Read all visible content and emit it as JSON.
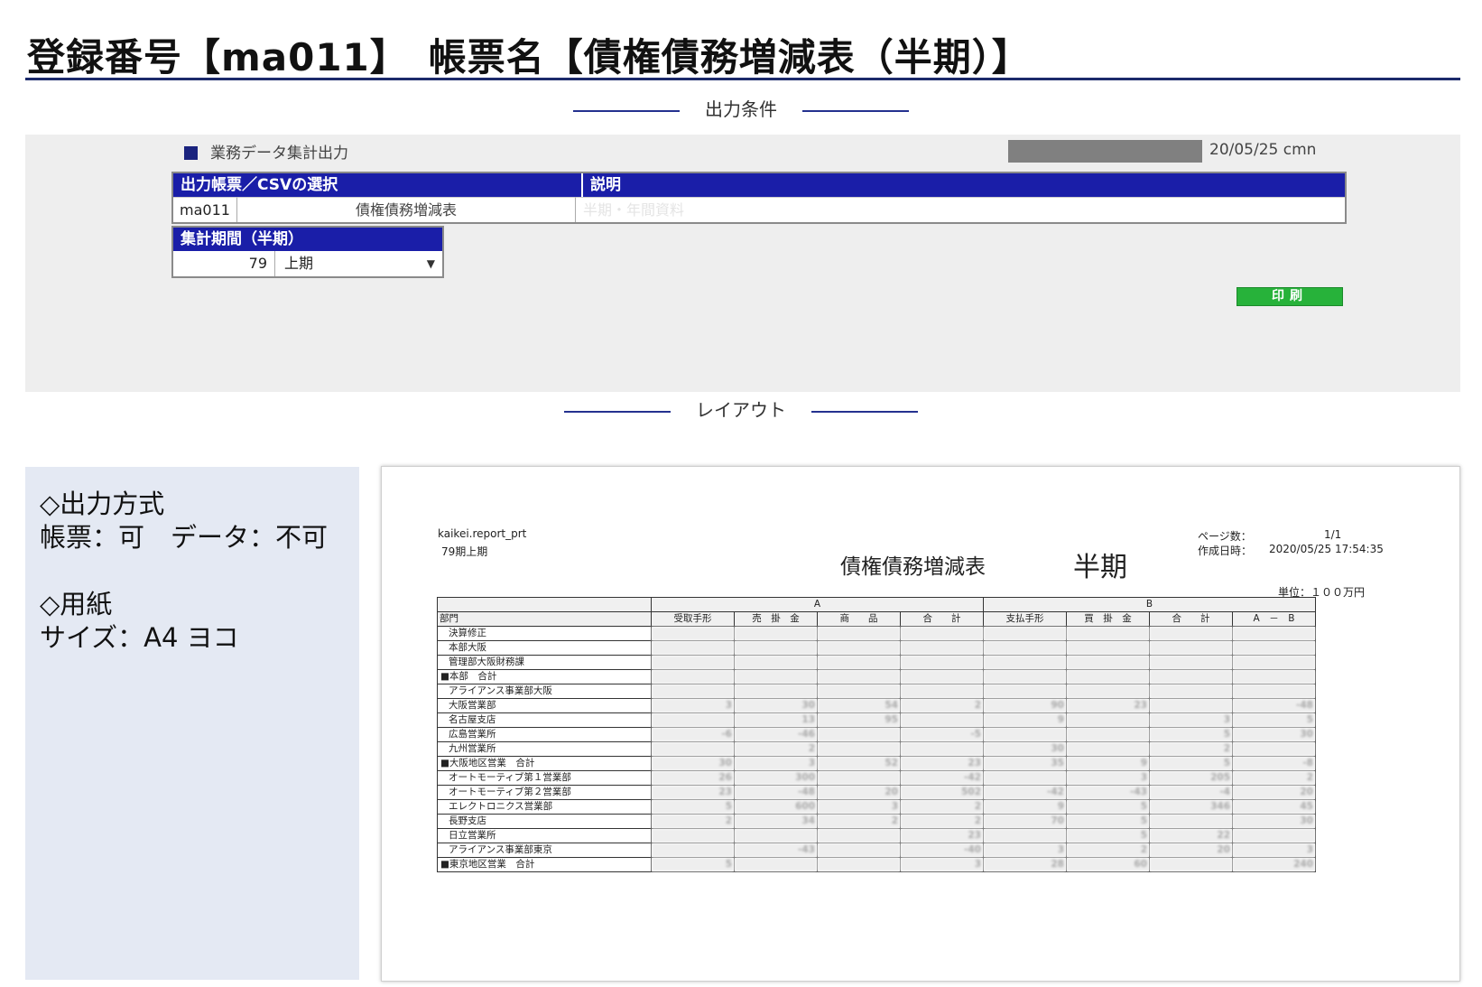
{
  "header": {
    "title": "登録番号【ma011】　帳票名【債権債務増減表（半期）】"
  },
  "sections": {
    "conditions": "出力条件",
    "layout": "レイアウト"
  },
  "conditions": {
    "system_name": "業務データ集計出力",
    "stamp": "20/05/25 cmn",
    "select_table": {
      "head_select": "出力帳票／CSVの選択",
      "head_desc": "説明",
      "code": "ma011",
      "name": "債権債務増減表",
      "desc": "半期・年間資料"
    },
    "period": {
      "head": "集計期間（半期）",
      "number": "79",
      "selected": "上期"
    },
    "print_label": "印刷"
  },
  "spec": {
    "method_heading": "◇出力方式",
    "method_value": "帳票：可　データ：不可",
    "paper_heading": "◇用紙",
    "paper_value": "サイズ：A4 ヨコ"
  },
  "preview": {
    "source": "kaikei.report_prt",
    "period": "79期上期",
    "title": "債権債務増減表",
    "half": "半期",
    "page_label": "ページ数：",
    "page_value": "1/1",
    "date_label": "作成日時：",
    "date_value": "2020/05/25 17:54:35",
    "unit": "単位：１００万円",
    "group_a": "A",
    "group_b": "B",
    "columns": [
      "部門",
      "受取手形",
      "売　掛　金",
      "商　　品",
      "合　　計",
      "支払手形",
      "買　掛　金",
      "合　　計",
      "A　－　B"
    ],
    "rows": [
      {
        "dept": "決算修正",
        "vals": [
          "",
          "",
          "",
          "",
          "",
          "",
          "",
          ""
        ]
      },
      {
        "dept": "本部大阪",
        "vals": [
          "",
          "",
          "",
          "",
          "",
          "",
          "",
          ""
        ]
      },
      {
        "dept": "管理部大阪財務課",
        "vals": [
          "",
          "",
          "",
          "",
          "",
          "",
          "",
          ""
        ]
      },
      {
        "dept": "■本部　合計",
        "vals": [
          "",
          "",
          "",
          "",
          "",
          "",
          "",
          ""
        ]
      },
      {
        "dept": "アライアンス事業部大阪",
        "vals": [
          "",
          "",
          "",
          "",
          "",
          "",
          "",
          ""
        ]
      },
      {
        "dept": "大阪営業部",
        "vals": [
          "3",
          "30",
          "54",
          "2",
          "90",
          "23",
          "",
          "-48"
        ]
      },
      {
        "dept": "名古屋支店",
        "vals": [
          "",
          "13",
          "95",
          "",
          "9",
          "",
          "3",
          "5"
        ]
      },
      {
        "dept": "広島営業所",
        "vals": [
          "-6",
          "-46",
          "",
          "-5",
          "",
          "",
          "5",
          "30"
        ]
      },
      {
        "dept": "九州営業所",
        "vals": [
          "",
          "2",
          "",
          "",
          "30",
          "",
          "2",
          ""
        ]
      },
      {
        "dept": "■大阪地区営業　合計",
        "vals": [
          "30",
          "3",
          "52",
          "23",
          "35",
          "9",
          "5",
          "-8"
        ]
      },
      {
        "dept": "オートモーティブ第１営業部",
        "vals": [
          "26",
          "300",
          "",
          "-42",
          "",
          "3",
          "205",
          "2"
        ]
      },
      {
        "dept": "オートモーティブ第２営業部",
        "vals": [
          "23",
          "-48",
          "20",
          "502",
          "-42",
          "-43",
          "-4",
          "20"
        ]
      },
      {
        "dept": "エレクトロニクス営業部",
        "vals": [
          "5",
          "600",
          "3",
          "2",
          "9",
          "5",
          "346",
          "45"
        ]
      },
      {
        "dept": "長野支店",
        "vals": [
          "2",
          "34",
          "2",
          "2",
          "70",
          "5",
          "",
          "30"
        ]
      },
      {
        "dept": "日立営業所",
        "vals": [
          "",
          "",
          "",
          "23",
          "",
          "5",
          "22",
          ""
        ]
      },
      {
        "dept": "アライアンス事業部東京",
        "vals": [
          "",
          "-43",
          "",
          "-40",
          "3",
          "2",
          "20",
          "3"
        ]
      },
      {
        "dept": "■東京地区営業　合計",
        "vals": [
          "5",
          "",
          "",
          "3",
          "28",
          "60",
          "",
          "240"
        ]
      }
    ]
  }
}
